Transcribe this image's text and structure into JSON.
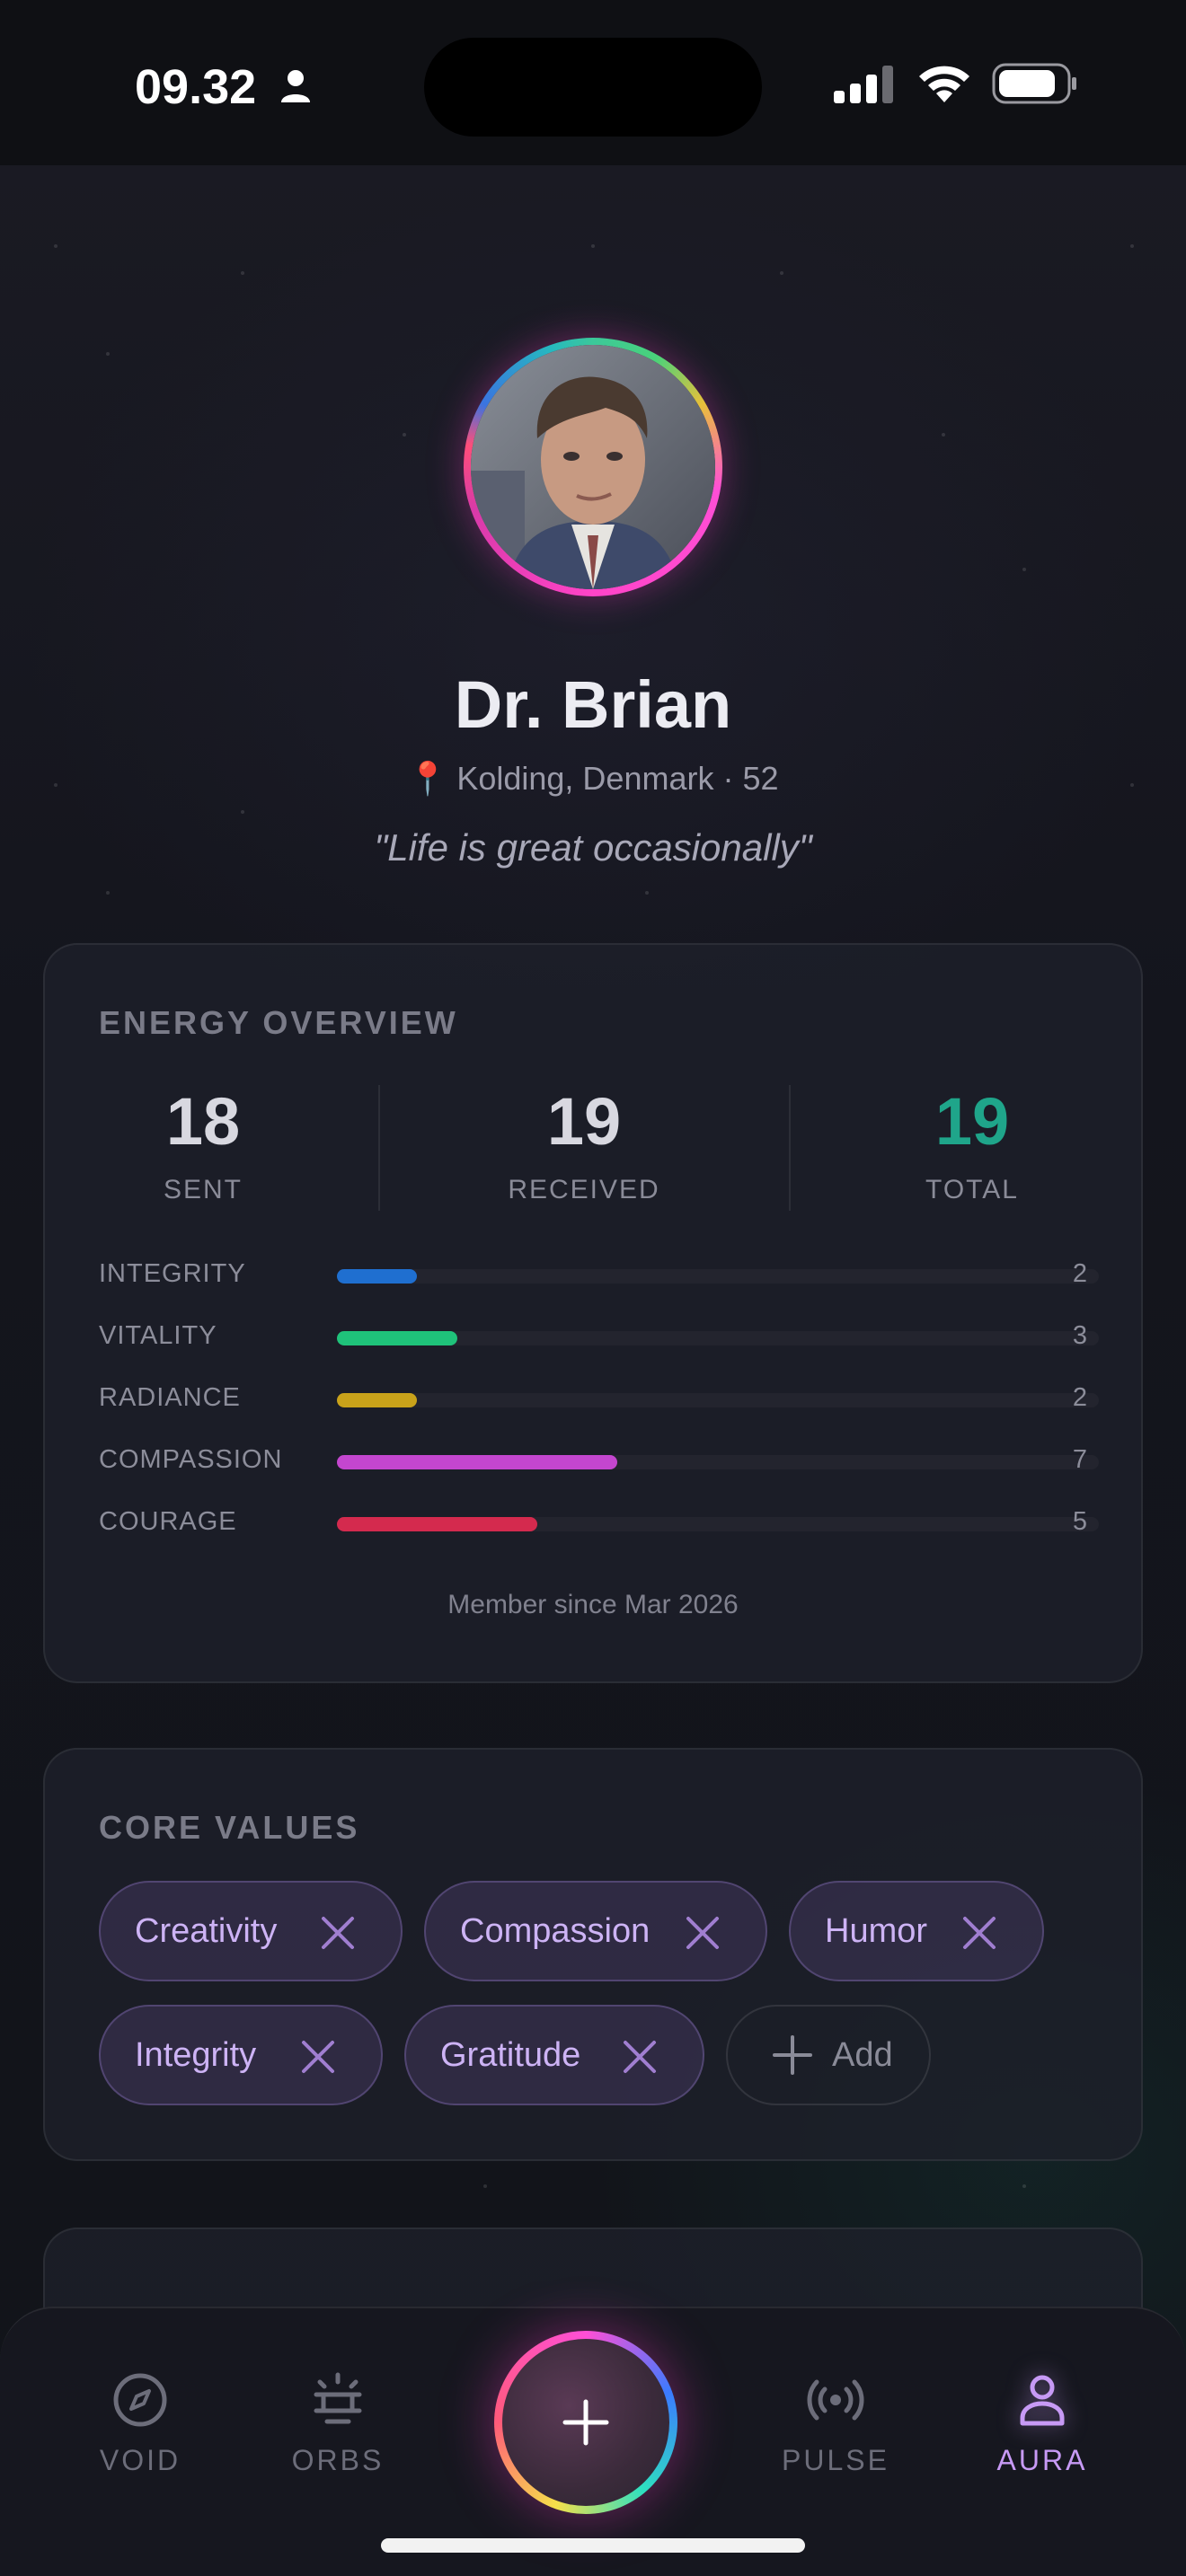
{
  "status_bar": {
    "time": "09.32"
  },
  "profile": {
    "name": "Dr. Brian",
    "location": "Kolding, Denmark · 52",
    "quote": "\"Life is great occasionally\""
  },
  "energy_overview": {
    "title": "ENERGY OVERVIEW",
    "stats": [
      {
        "value": "18",
        "label": "SENT"
      },
      {
        "value": "19",
        "label": "RECEIVED"
      },
      {
        "value": "19",
        "label": "TOTAL"
      }
    ],
    "bars": [
      {
        "label": "INTEGRITY",
        "value": 2,
        "color": "#1f6fd0"
      },
      {
        "label": "VITALITY",
        "value": 3,
        "color": "#1fc27a"
      },
      {
        "label": "RADIANCE",
        "value": 2,
        "color": "#c9a21a"
      },
      {
        "label": "COMPASSION",
        "value": 7,
        "color": "#c446cf"
      },
      {
        "label": "COURAGE",
        "value": 5,
        "color": "#d42a4e"
      }
    ],
    "bar_max": 19,
    "member_since": "Member since Mar 2026"
  },
  "core_values": {
    "title": "CORE VALUES",
    "values": [
      "Creativity",
      "Compassion",
      "Humor",
      "Integrity",
      "Gratitude"
    ],
    "add_label": "Add"
  },
  "nav": {
    "items": [
      {
        "label": "VOID",
        "icon": "compass-icon"
      },
      {
        "label": "ORBS",
        "icon": "orbs-icon"
      },
      {
        "label": "PULSE",
        "icon": "broadcast-icon"
      },
      {
        "label": "AURA",
        "icon": "person-icon"
      }
    ],
    "active": "AURA"
  },
  "colors": {
    "accent": "#c79af5",
    "total": "#1fa58a"
  }
}
